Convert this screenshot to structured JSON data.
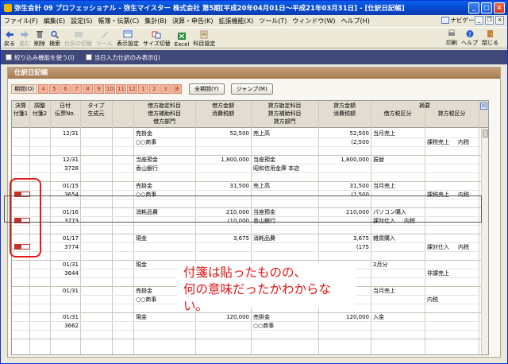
{
  "window": {
    "title": "弥生会計 09 プロフェッショナル - 弥生マイスター 株式会社 第5期[平成20年04月01日～平成21年03月31日] - [仕訳日記帳]"
  },
  "menu": [
    "ファイル(F)",
    "編集(E)",
    "設定(S)",
    "帳簿・伝票(C)",
    "集計(B)",
    "決算・申告(K)",
    "拡張機能(X)",
    "ツール(T)",
    "ウィンドウ(W)",
    "ヘルプ(H)"
  ],
  "navi": "ナビゲータ",
  "toolbar": [
    "戻る",
    "進む",
    "削除",
    "検索",
    "仕訳の切替",
    "ツール",
    "表示設定",
    "サイズ切替",
    "Excel",
    "科目設定"
  ],
  "right_tools": [
    "印刷",
    "ヘルプ",
    "閉じる"
  ],
  "options": [
    "絞り込み機能を使う(I)",
    "当日入力仕訳のみ表示(J)"
  ],
  "panel_title": "仕訳日記帳",
  "period": {
    "label": "期間(O)",
    "months": [
      "4",
      "5",
      "6",
      "7",
      "8",
      "9",
      "10",
      "11",
      "12",
      "1",
      "2",
      "3",
      "決"
    ],
    "all_button": "全期間(Y)",
    "jump_button": "ジャンプ(M)"
  },
  "headers": {
    "kessai": "決算",
    "chosei": "調整",
    "hizuke": "日付",
    "taipu": "タイプ",
    "fusen1": "付箋1",
    "fusen2": "付箋2",
    "denpyo": "伝票No.",
    "seisei": "生成元",
    "debit_account": "借方勘定科目",
    "debit_sub": "借方補助科目",
    "debit_dept": "借方部門",
    "debit_amount": "借方金額",
    "debit_tax": "消費税額",
    "credit_account": "貸方勘定科目",
    "credit_sub": "貸方補助科目",
    "credit_dept": "貸方部門",
    "credit_amount": "貸方金額",
    "credit_tax": "消費税額",
    "memo": "摘要",
    "debit_taxcat": "借方税区分",
    "credit_taxcat": "貸方税区分"
  },
  "rows": [
    {
      "date": "12/31",
      "no": "",
      "d_acc": "売掛金",
      "d_sub": "○○商事",
      "d_amt": "52,500",
      "d_tax": "",
      "c_acc": "売上高",
      "c_sub": "",
      "c_amt": "52,500",
      "c_tax": "(2,500",
      "memo": "当月売上",
      "d_cat": "",
      "c_cat": "課税売上",
      "c_cat2": "内税",
      "sticky": false
    },
    {
      "date": "12/31",
      "no": "3728",
      "d_acc": "当座預金",
      "d_sub": "香山銀行",
      "d_amt": "1,800,000",
      "d_tax": "",
      "c_acc": "当座預金",
      "c_sub": "昭和信用金庫 本店",
      "c_amt": "1,800,000",
      "c_tax": "",
      "memo": "振替",
      "d_cat": "",
      "c_cat": "",
      "c_cat2": "",
      "sticky": false
    },
    {
      "date": "01/15",
      "no": "3654",
      "d_acc": "売掛金",
      "d_sub": "○○商事",
      "d_amt": "31,500",
      "d_tax": "",
      "c_acc": "売上高",
      "c_sub": "",
      "c_amt": "31,500",
      "c_tax": "(1,500",
      "memo": "当月売上",
      "d_cat": "",
      "c_cat": "課税売上",
      "c_cat2": "内税",
      "sticky": true
    },
    {
      "date": "01/16",
      "no": "3773",
      "d_acc": "消耗品費",
      "d_sub": "",
      "d_amt": "210,000",
      "d_tax": "(10,000",
      "c_acc": "当座預金",
      "c_sub": "香山銀行",
      "c_amt": "210,000",
      "c_tax": "",
      "memo": "パソコン購入",
      "d_cat": "課対仕入",
      "d_cat2": "内税",
      "c_cat": "",
      "c_cat2": "",
      "sticky": true
    },
    {
      "date": "01/17",
      "no": "3774",
      "d_acc": "現金",
      "d_sub": "",
      "d_amt": "3,675",
      "d_tax": "",
      "c_acc": "消耗品費",
      "c_sub": "",
      "c_amt": "3,675",
      "c_tax": "(175",
      "memo": "雑貨購入",
      "d_cat": "",
      "c_cat": "課対仕入",
      "c_cat2": "内税",
      "sticky": true
    },
    {
      "date": "01/31",
      "no": "3644",
      "d_acc": "現金",
      "d_sub": "",
      "d_amt": "",
      "d_tax": "",
      "c_acc": "",
      "c_sub": "",
      "c_amt": "",
      "c_tax": "",
      "memo": "2月分",
      "d_cat": "",
      "c_cat": "非課売上",
      "c_cat2": "",
      "sticky": false
    },
    {
      "date": "01/31",
      "no": "",
      "d_acc": "売掛金",
      "d_sub": "○○商事",
      "d_amt": "",
      "d_tax": "",
      "c_acc": "",
      "c_sub": "",
      "c_amt": "",
      "c_tax": "",
      "memo": "当月売上",
      "d_cat": "",
      "c_cat": "内税",
      "c_cat2": "",
      "sticky": false
    },
    {
      "date": "01/31",
      "no": "3662",
      "d_acc": "現金",
      "d_sub": "",
      "d_amt": "120,000",
      "d_tax": "",
      "c_acc": "売掛金",
      "c_sub": "○○商事",
      "c_amt": "120,000",
      "c_tax": "",
      "memo": "入金",
      "d_cat": "",
      "c_cat": "",
      "c_cat2": "",
      "sticky": false
    }
  ],
  "callout": {
    "line1": "付箋は貼ったものの、",
    "line2": "何の意味だったかわからない。"
  }
}
